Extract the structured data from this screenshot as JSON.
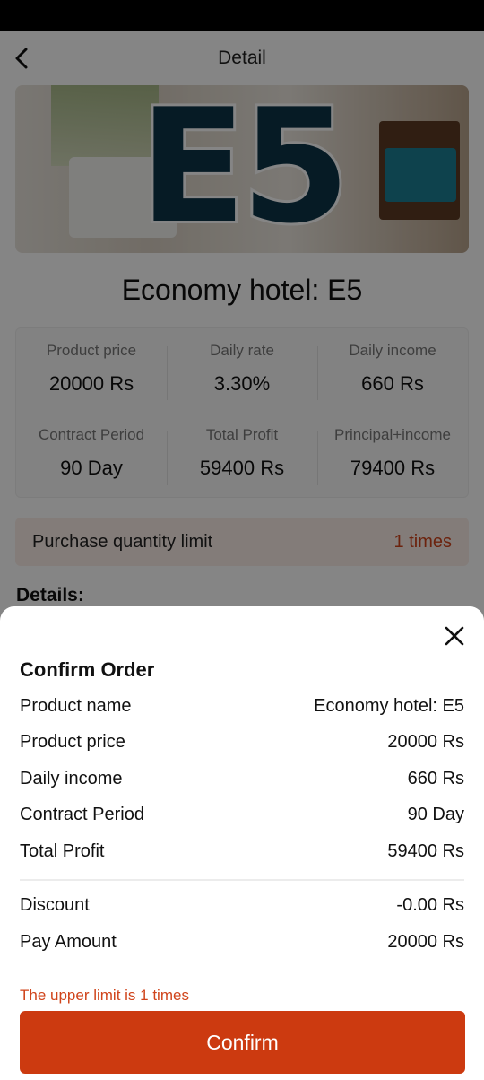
{
  "header": {
    "title": "Detail"
  },
  "banner": {
    "text": "E5"
  },
  "product": {
    "title": "Economy hotel: E5"
  },
  "stats": [
    {
      "label": "Product price",
      "value": "20000 Rs"
    },
    {
      "label": "Daily rate",
      "value": "3.30%"
    },
    {
      "label": "Daily income",
      "value": "660 Rs"
    },
    {
      "label": "Contract Period",
      "value": "90 Day"
    },
    {
      "label": "Total Profit",
      "value": "59400 Rs"
    },
    {
      "label": "Principal+income",
      "value": "79400 Rs"
    }
  ],
  "limit": {
    "label": "Purchase quantity limit",
    "value": "1 times"
  },
  "details": {
    "heading": "Details:"
  },
  "sheet": {
    "title": "Confirm Order",
    "rows": [
      {
        "label": "Product name",
        "value": "Economy hotel: E5"
      },
      {
        "label": "Product price",
        "value": "20000 Rs"
      },
      {
        "label": "Daily income",
        "value": "660 Rs"
      },
      {
        "label": "Contract Period",
        "value": "90 Day"
      },
      {
        "label": "Total Profit",
        "value": "59400 Rs"
      },
      {
        "label": "Discount",
        "value": "-0.00 Rs"
      },
      {
        "label": "Pay Amount",
        "value": "20000 Rs"
      }
    ],
    "warning": "The upper limit is 1 times",
    "confirm_label": "Confirm"
  },
  "colors": {
    "accent": "#cc3a10",
    "warning": "#d0441b",
    "limit_bg": "#fbeee9"
  },
  "icons": {
    "back": "chevron-left-icon",
    "close": "close-icon"
  }
}
